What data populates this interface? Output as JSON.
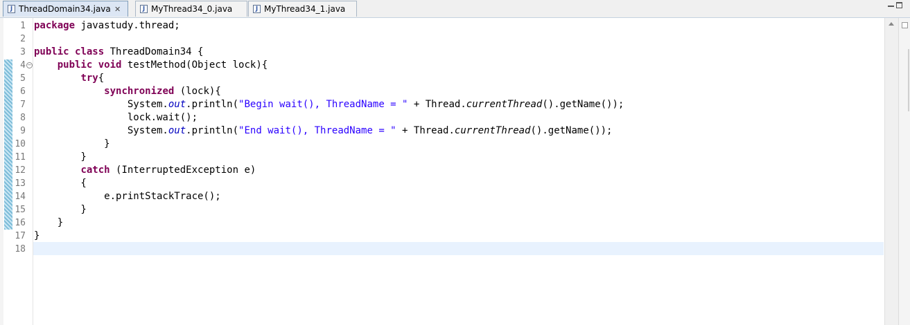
{
  "tabs": [
    {
      "label": "ThreadDomain34.java",
      "icon": "java-file-icon",
      "active": true,
      "close_glyph": "✕"
    },
    {
      "label": "MyThread34_0.java",
      "icon": "java-file-icon",
      "active": false
    },
    {
      "label": "MyThread34_1.java",
      "icon": "java-file-icon",
      "active": false
    }
  ],
  "window_controls": [
    "minimize-icon",
    "maximize-icon"
  ],
  "editor": {
    "line_numbers": [
      "1",
      "2",
      "3",
      "4",
      "5",
      "6",
      "7",
      "8",
      "9",
      "10",
      "11",
      "12",
      "13",
      "14",
      "15",
      "16",
      "17",
      "18"
    ],
    "fold_marker": "⊖",
    "current_line": 18,
    "lines": [
      [
        {
          "t": "package",
          "s": "kw"
        },
        {
          "t": " javastudy.thread;"
        }
      ],
      [],
      [
        {
          "t": "public",
          "s": "kw"
        },
        {
          "t": " "
        },
        {
          "t": "class",
          "s": "kw"
        },
        {
          "t": " ThreadDomain34 {"
        }
      ],
      [
        {
          "t": "    "
        },
        {
          "t": "public",
          "s": "kw"
        },
        {
          "t": " "
        },
        {
          "t": "void",
          "s": "kw"
        },
        {
          "t": " testMethod(Object lock){"
        }
      ],
      [
        {
          "t": "        "
        },
        {
          "t": "try",
          "s": "kw"
        },
        {
          "t": "{"
        }
      ],
      [
        {
          "t": "            "
        },
        {
          "t": "synchronized",
          "s": "kw"
        },
        {
          "t": " (lock){"
        }
      ],
      [
        {
          "t": "                System."
        },
        {
          "t": "out",
          "s": "fld"
        },
        {
          "t": ".println("
        },
        {
          "t": "\"Begin wait(), ThreadName = \"",
          "s": "str"
        },
        {
          "t": " + Thread."
        },
        {
          "t": "currentThread",
          "s": "itl"
        },
        {
          "t": "().getName());"
        }
      ],
      [
        {
          "t": "                lock.wait();"
        }
      ],
      [
        {
          "t": "                System."
        },
        {
          "t": "out",
          "s": "fld"
        },
        {
          "t": ".println("
        },
        {
          "t": "\"End wait(), ThreadName = \"",
          "s": "str"
        },
        {
          "t": " + Thread."
        },
        {
          "t": "currentThread",
          "s": "itl"
        },
        {
          "t": "().getName());"
        }
      ],
      [
        {
          "t": "            }"
        }
      ],
      [
        {
          "t": "        }"
        }
      ],
      [
        {
          "t": "        "
        },
        {
          "t": "catch",
          "s": "kw"
        },
        {
          "t": " (InterruptedException e)"
        }
      ],
      [
        {
          "t": "        {"
        }
      ],
      [
        {
          "t": "            e.printStackTrace();"
        }
      ],
      [
        {
          "t": "        }"
        }
      ],
      [
        {
          "t": "    }"
        }
      ],
      [
        {
          "t": "}"
        }
      ],
      []
    ]
  },
  "colors": {
    "keyword": "#7f0055",
    "string": "#2a00ff",
    "static_field": "#0000c0",
    "current_line_bg": "#e8f2fe",
    "active_tab_bg": "#dce6f4"
  }
}
